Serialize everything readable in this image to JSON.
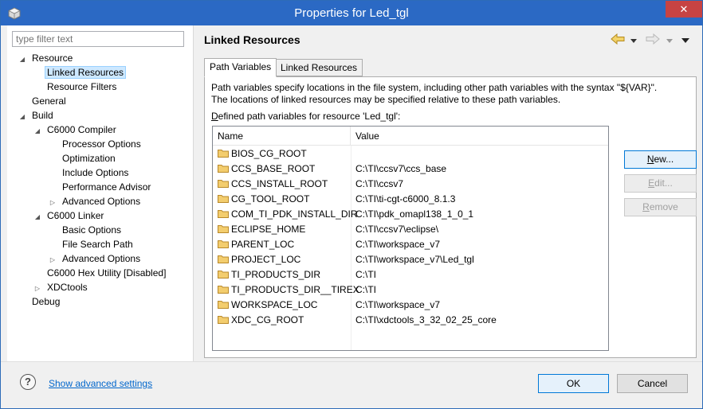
{
  "window": {
    "title": "Properties for Led_tgl",
    "close_glyph": "✕",
    "app_icon": "eclipse-cube-icon"
  },
  "filter": {
    "placeholder": "type filter text"
  },
  "tree": [
    {
      "label": "Resource",
      "toggle": "◢",
      "level": 0
    },
    {
      "label": "Linked Resources",
      "toggle": "",
      "level": 1,
      "selected": true
    },
    {
      "label": "Resource Filters",
      "toggle": "",
      "level": 1
    },
    {
      "label": "General",
      "toggle": "",
      "level": 0
    },
    {
      "label": "Build",
      "toggle": "◢",
      "level": 0
    },
    {
      "label": "C6000 Compiler",
      "toggle": "◢",
      "level": 1
    },
    {
      "label": "Processor Options",
      "toggle": "",
      "level": 2
    },
    {
      "label": "Optimization",
      "toggle": "",
      "level": 2
    },
    {
      "label": "Include Options",
      "toggle": "",
      "level": 2
    },
    {
      "label": "Performance Advisor",
      "toggle": "",
      "level": 2
    },
    {
      "label": "Advanced Options",
      "toggle": "▷",
      "level": 2
    },
    {
      "label": "C6000 Linker",
      "toggle": "◢",
      "level": 1
    },
    {
      "label": "Basic Options",
      "toggle": "",
      "level": 2
    },
    {
      "label": "File Search Path",
      "toggle": "",
      "level": 2
    },
    {
      "label": "Advanced Options",
      "toggle": "▷",
      "level": 2
    },
    {
      "label": "C6000 Hex Utility  [Disabled]",
      "toggle": "",
      "level": 1
    },
    {
      "label": "XDCtools",
      "toggle": "▷",
      "level": 1
    },
    {
      "label": "Debug",
      "toggle": "",
      "level": 0
    }
  ],
  "page": {
    "title": "Linked Resources",
    "nav_icons": [
      "back-arrow-icon",
      "dropdown-icon",
      "forward-arrow-icon",
      "dropdown-icon",
      "menu-icon"
    ]
  },
  "tabs": [
    {
      "label": "Path Variables",
      "active": true
    },
    {
      "label": "Linked Resources",
      "active": false
    }
  ],
  "description": {
    "line1": "Path variables specify locations in the file system, including other path variables with the syntax \"${VAR}\".",
    "line2": "The locations of linked resources may be specified relative to these path variables."
  },
  "table": {
    "caption_prefix": "D",
    "caption_rest": "efined path variables for resource 'Led_tgl':",
    "columns": [
      "Name",
      "Value"
    ],
    "rows": [
      {
        "name": "BIOS_CG_ROOT",
        "value": ""
      },
      {
        "name": "CCS_BASE_ROOT",
        "value": "C:\\TI\\ccsv7\\ccs_base"
      },
      {
        "name": "CCS_INSTALL_ROOT",
        "value": "C:\\TI\\ccsv7"
      },
      {
        "name": "CG_TOOL_ROOT",
        "value": "C:\\TI\\ti-cgt-c6000_8.1.3"
      },
      {
        "name": "COM_TI_PDK_INSTALL_DIR",
        "value": "C:\\TI\\pdk_omapl138_1_0_1"
      },
      {
        "name": "ECLIPSE_HOME",
        "value": "C:\\TI\\ccsv7\\eclipse\\"
      },
      {
        "name": "PARENT_LOC",
        "value": "C:\\TI\\workspace_v7"
      },
      {
        "name": "PROJECT_LOC",
        "value": "C:\\TI\\workspace_v7\\Led_tgl"
      },
      {
        "name": "TI_PRODUCTS_DIR",
        "value": "C:\\TI"
      },
      {
        "name": "TI_PRODUCTS_DIR__TIREX",
        "value": "C:\\TI"
      },
      {
        "name": "WORKSPACE_LOC",
        "value": "C:\\TI\\workspace_v7"
      },
      {
        "name": "XDC_CG_ROOT",
        "value": "C:\\TI\\xdctools_3_32_02_25_core"
      }
    ]
  },
  "buttons": {
    "new_mn": "N",
    "new_rest": "ew...",
    "edit_mn": "E",
    "edit_rest": "dit...",
    "remove_mn": "R",
    "remove_rest": "emove"
  },
  "bottom": {
    "help_glyph": "?",
    "advanced_link": "Show advanced settings",
    "ok": "OK",
    "cancel": "Cancel"
  },
  "colors": {
    "titlebar": "#2b69c4",
    "close": "#c74343",
    "selection": "#cde8ff",
    "link": "#0066cc",
    "folder": "#e8b84a"
  }
}
